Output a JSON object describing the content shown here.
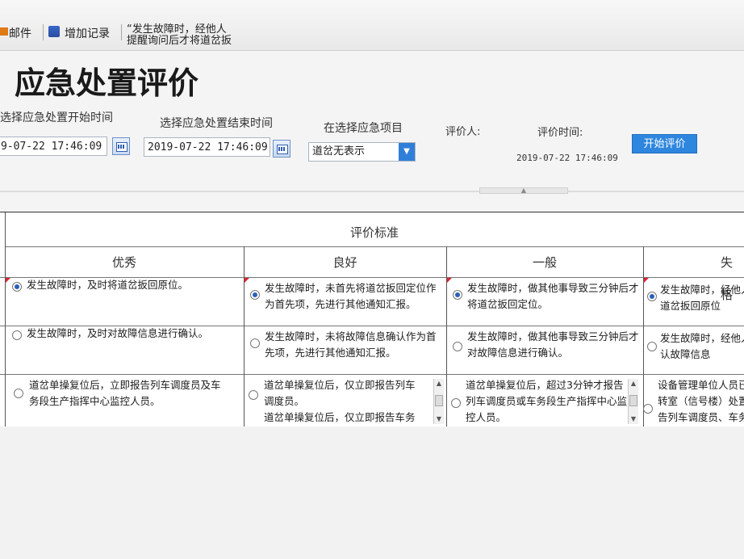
{
  "toolbar": {
    "mail_label": "邮件",
    "add_record_label": "增加记录",
    "note_line1": "“发生故障时，经他人",
    "note_line2": "提醒询问后才将道岔扳"
  },
  "page": {
    "title": "应急处置评价"
  },
  "filters": {
    "start_label": "选择应急处置开始时间",
    "start_value": "9-07-22 17:46:09",
    "end_label": "选择应急处置结束时间",
    "end_value": "2019-07-22 17:46:09",
    "item_label": "在选择应急项目",
    "item_value": "道岔无表示",
    "evaluator_label": "评价人:",
    "time_label": "评价时间:",
    "time_value": "2019-07-22 17:46:09",
    "start_button": "开始评价"
  },
  "table": {
    "header": "评价标准",
    "columns": [
      "优秀",
      "良好",
      "一般",
      "失格"
    ],
    "rows": [
      {
        "selected": [
          true,
          true,
          true,
          true
        ],
        "cells": [
          [
            "发生故障时，及时将道岔扳回原位。"
          ],
          [
            "发生故障时，未首先将道岔扳回定位作",
            "为首先项，先进行其他通知汇报。"
          ],
          [
            "发生故障时，做其他事导致三分钟后才",
            "将道岔扳回定位。"
          ],
          [
            "发生故障时，经他人",
            "道岔扳回原位"
          ]
        ]
      },
      {
        "selected": [
          false,
          false,
          false,
          false
        ],
        "cells": [
          [
            "发生故障时，及时对故障信息进行确认。"
          ],
          [
            "发生故障时，未将故障信息确认作为首",
            "先项，先进行其他通知汇报。"
          ],
          [
            "发生故障时，做其他事导致三分钟后才",
            "对故障信息进行确认。"
          ],
          [
            "发生故障时，经他人",
            "认故障信息"
          ]
        ]
      },
      {
        "selected": [
          false,
          false,
          false,
          false
        ],
        "cells": [
          [
            "道岔单操复位后，立即报告列车调度员及车",
            "务段生产指挥中心监控人员。"
          ],
          [
            "道岔单操复位后，仅立即报告列车",
            "调度员。",
            "道岔单操复位后，仅立即报告车务"
          ],
          [
            "道岔单操复位后，超过3分钟才报告",
            "列车调度员或车务段生产指挥中心监",
            "控人员。"
          ],
          [
            "设备管理单位人员已",
            "转室（信号楼）处置",
            "告列车调度员、车务"
          ]
        ]
      }
    ]
  }
}
